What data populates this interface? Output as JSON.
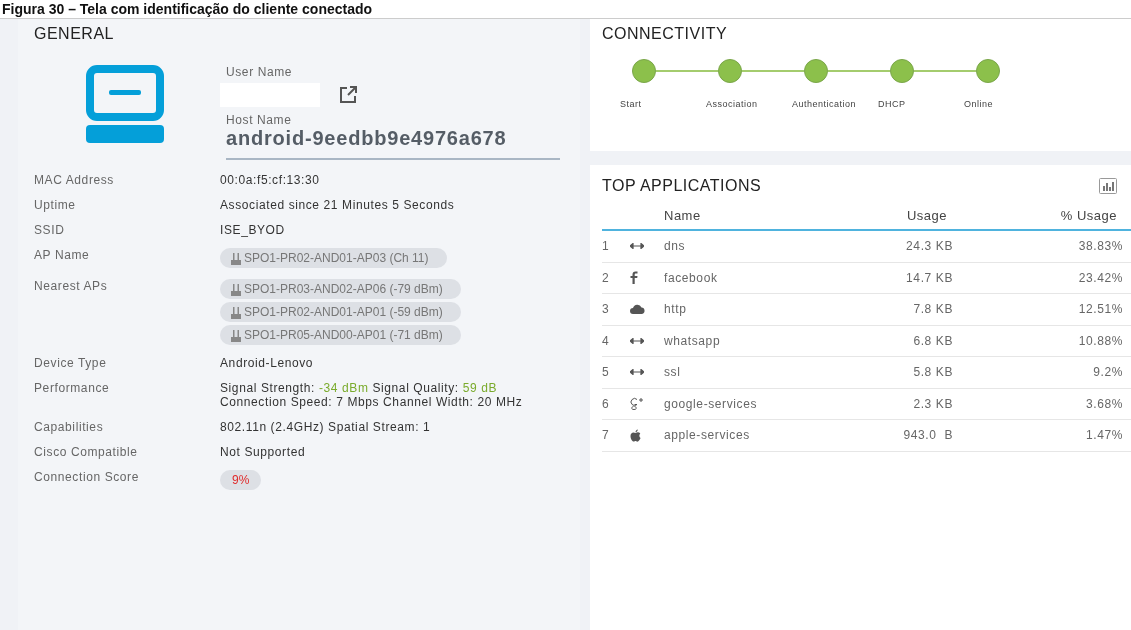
{
  "caption": "Figura 30 – Tela com identificação do cliente conectado",
  "general": {
    "title": "GENERAL",
    "user_name_label": "User Name",
    "host_name_label": "Host Name",
    "host_name": "android-9eedbb9e4976a678",
    "rows": [
      {
        "kind": "text",
        "label": "MAC Address",
        "value": "00:0a:f5:cf:13:30"
      },
      {
        "kind": "text",
        "label": "Uptime",
        "value": "Associated since 21 Minutes 5 Seconds"
      },
      {
        "kind": "text",
        "label": "SSID",
        "value": "ISE_BYOD"
      },
      {
        "kind": "chips",
        "label": "AP Name",
        "chips": [
          "SPO1-PR02-AND01-AP03 (Ch 11)"
        ]
      },
      {
        "kind": "chips",
        "label": "Nearest APs",
        "chips": [
          "SPO1-PR03-AND02-AP06 (-79 dBm)",
          "SPO1-PR02-AND01-AP01 (-59 dBm)",
          "SPO1-PR05-AND00-AP01 (-71 dBm)"
        ]
      },
      {
        "kind": "text",
        "label": "Device Type",
        "value": "Android-Lenovo"
      },
      {
        "kind": "segments",
        "label": "Performance",
        "segments": [
          {
            "text": "Signal Strength: ",
            "highlight": false
          },
          {
            "text": "-34 dBm",
            "highlight": true
          },
          {
            "text": " Signal Quality: ",
            "highlight": false
          },
          {
            "text": "59 dB",
            "highlight": true
          },
          {
            "text": " Connection Speed: 7 Mbps Channel Width: 20 MHz",
            "highlight": false
          }
        ]
      },
      {
        "kind": "text",
        "label": "Capabilities",
        "value": "802.11n (2.4GHz) Spatial Stream: 1"
      },
      {
        "kind": "text",
        "label": "Cisco Compatible",
        "value": "Not Supported"
      },
      {
        "kind": "score",
        "label": "Connection Score",
        "value": "9%"
      }
    ]
  },
  "connectivity": {
    "title": "CONNECTIVITY",
    "steps": [
      {
        "label": "Start",
        "done": true
      },
      {
        "label": "Association",
        "done": true
      },
      {
        "label": "Authentication",
        "done": true
      },
      {
        "label": "DHCP",
        "done": true
      },
      {
        "label": "Online",
        "done": true
      }
    ]
  },
  "top_applications": {
    "title": "TOP APPLICATIONS",
    "columns": [
      "Name",
      "Usage",
      "% Usage"
    ],
    "rows": [
      {
        "rank": "1",
        "kind": "arrows",
        "name": "dns",
        "usage": "24.3 KB",
        "percent": "38.83%"
      },
      {
        "rank": "2",
        "kind": "facebook",
        "name": "facebook",
        "usage": "14.7 KB",
        "percent": "23.42%"
      },
      {
        "rank": "3",
        "kind": "cloud",
        "name": "http",
        "usage": "7.8 KB",
        "percent": "12.51%"
      },
      {
        "rank": "4",
        "kind": "arrows",
        "name": "whatsapp",
        "usage": "6.8 KB",
        "percent": "10.88%"
      },
      {
        "rank": "5",
        "kind": "arrows",
        "name": "ssl",
        "usage": "5.8 KB",
        "percent": "9.2%"
      },
      {
        "rank": "6",
        "kind": "gplus",
        "name": "google-services",
        "usage": "2.3 KB",
        "percent": "3.68%"
      },
      {
        "rank": "7",
        "kind": "apple",
        "name": "apple-services",
        "usage": "943.0  B",
        "percent": "1.47%"
      }
    ]
  }
}
